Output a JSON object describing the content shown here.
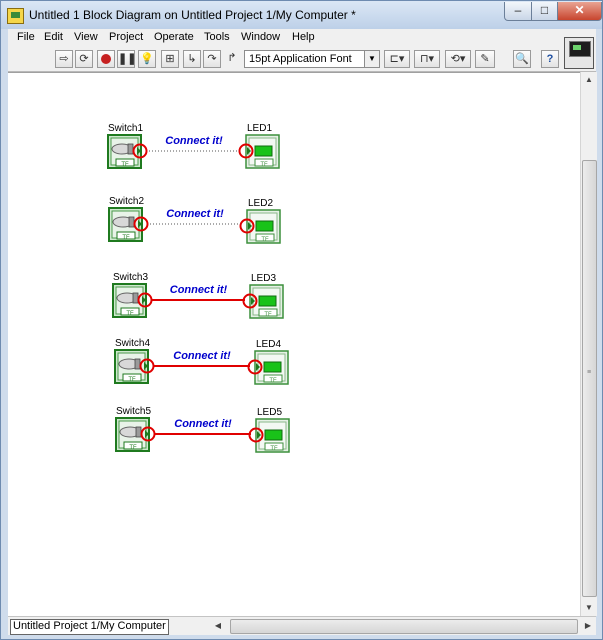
{
  "window": {
    "title": "Untitled 1 Block Diagram on Untitled Project 1/My Computer *",
    "controls": {
      "minimize": "–",
      "maximize": "□",
      "close": "✕"
    }
  },
  "menu": [
    "File",
    "Edit",
    "View",
    "Project",
    "Operate",
    "Tools",
    "Window",
    "Help"
  ],
  "toolbar": {
    "font_select": "15pt Application Font",
    "icons": [
      "run-arrow-icon",
      "run-continuously-icon",
      "abort-icon",
      "pause-icon",
      "highlight-execution-icon",
      "retain-wire-values-icon",
      "step-into-icon",
      "step-over-icon",
      "step-out-icon",
      "align-objects-icon",
      "distribute-objects-icon",
      "reorder-icon",
      "clean-up-diagram-icon",
      "search-icon",
      "help-icon"
    ]
  },
  "diagram": {
    "connect_label": "Connect it!",
    "terminal_tf": "TF",
    "pairs": [
      {
        "switch": "Switch1",
        "led": "LED1",
        "wire": "broken"
      },
      {
        "switch": "Switch2",
        "led": "LED2",
        "wire": "broken"
      },
      {
        "switch": "Switch3",
        "led": "LED3",
        "wire": "solid"
      },
      {
        "switch": "Switch4",
        "led": "LED4",
        "wire": "solid"
      },
      {
        "switch": "Switch5",
        "led": "LED5",
        "wire": "solid"
      }
    ],
    "colors": {
      "terminal_green": "#1f7a1f",
      "wire_red": "#e00000",
      "label_blue": "#0000cc",
      "led_green": "#19c219"
    }
  },
  "status": {
    "project_path": "Untitled Project 1/My Computer"
  }
}
